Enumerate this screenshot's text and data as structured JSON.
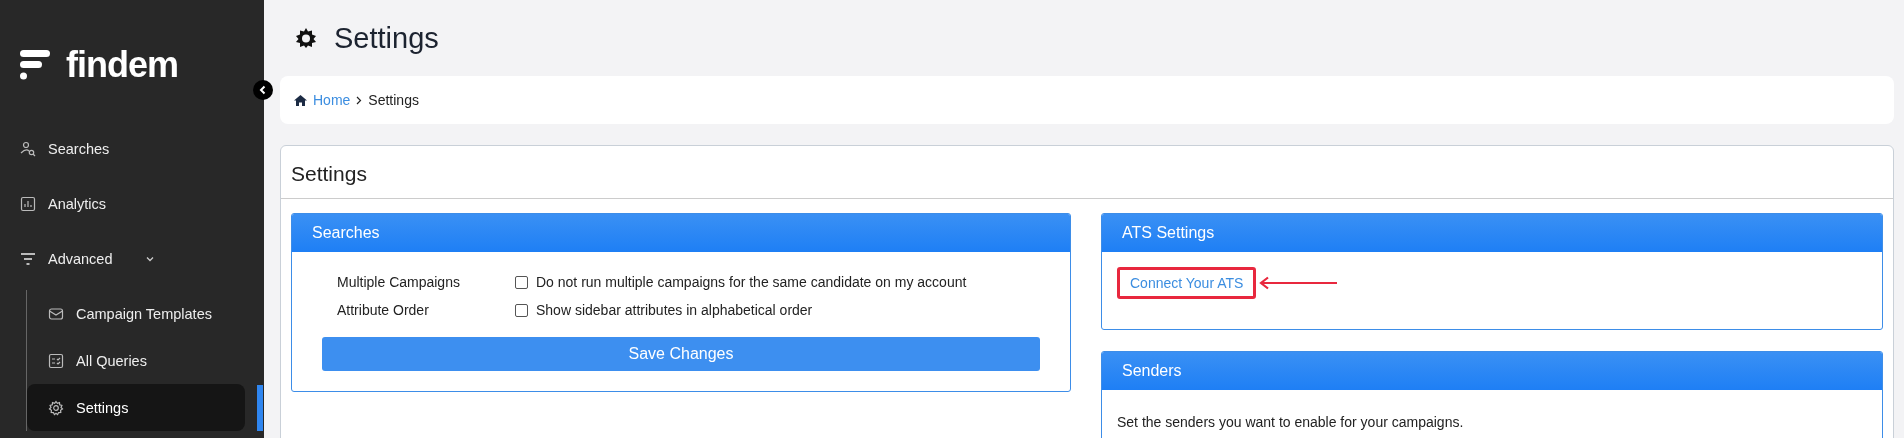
{
  "sidebar": {
    "logo": "findem",
    "items": [
      {
        "label": "Searches",
        "selected": false
      },
      {
        "label": "Analytics",
        "selected": false
      },
      {
        "label": "Advanced",
        "selected": false,
        "expanded": true,
        "children": [
          {
            "label": "Campaign Templates",
            "selected": false
          },
          {
            "label": "All Queries",
            "selected": false
          },
          {
            "label": "Settings",
            "selected": true
          }
        ]
      }
    ]
  },
  "page_title": "Settings",
  "breadcrumb": [
    {
      "label": "Home",
      "kind": "link"
    },
    {
      "label": "Settings",
      "kind": "current"
    }
  ],
  "card_title": "Settings",
  "searches_panel": {
    "title": "Searches",
    "rows": [
      {
        "label": "Multiple Campaigns",
        "option": "Do not run multiple campaigns for the same candidate on my account",
        "checked": false
      },
      {
        "label": "Attribute Order",
        "option": "Show sidebar attributes in alphabetical order",
        "checked": false
      }
    ],
    "button": "Save Changes"
  },
  "ats_panel": {
    "title": "ATS Settings",
    "link": "Connect Your ATS",
    "highlighted": true
  },
  "senders_panel": {
    "title": "Senders",
    "text": "Set the senders you want to enable for your campaigns."
  }
}
